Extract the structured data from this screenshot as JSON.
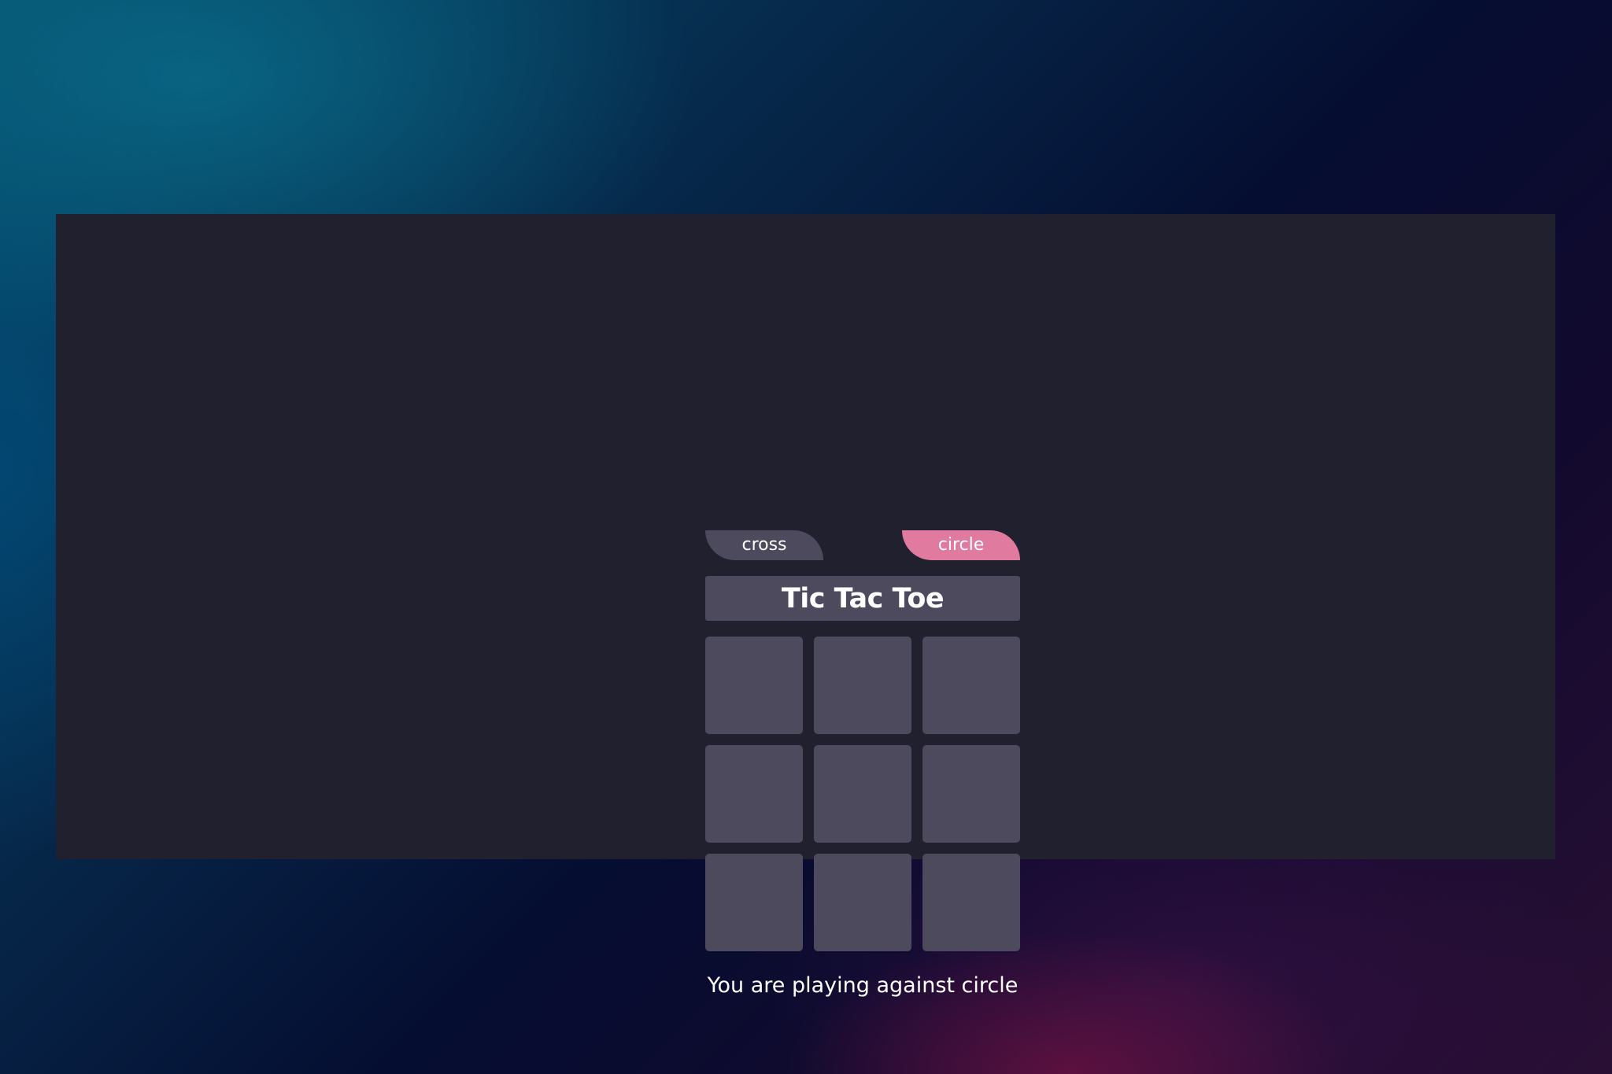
{
  "turn_tabs": {
    "cross_label": "cross",
    "circle_label": "circle",
    "active": "circle"
  },
  "title": "Tic Tac Toe",
  "board": {
    "cells": [
      "",
      "",
      "",
      "",
      "",
      "",
      "",
      "",
      ""
    ]
  },
  "status_text": "You are playing against circle",
  "colors": {
    "panel": "#20202f",
    "tile": "#4d4a5e",
    "active_tab": "#e07b9f",
    "text": "#ffffff"
  }
}
